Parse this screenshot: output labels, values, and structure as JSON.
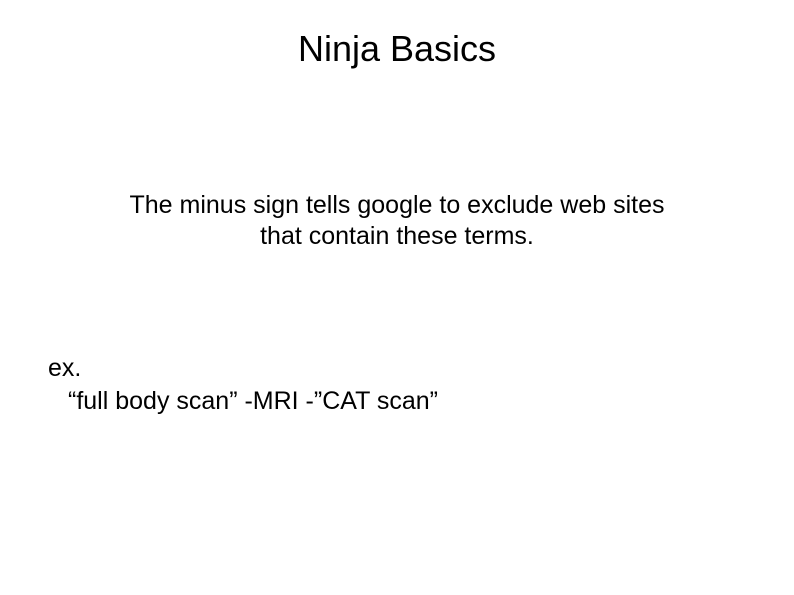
{
  "title": "Ninja Basics",
  "body": {
    "line1": "The minus sign tells google to exclude web sites",
    "line2": "that contain these terms."
  },
  "example": {
    "label": "ex.",
    "query": "“full body scan” -MRI -”CAT scan”"
  }
}
